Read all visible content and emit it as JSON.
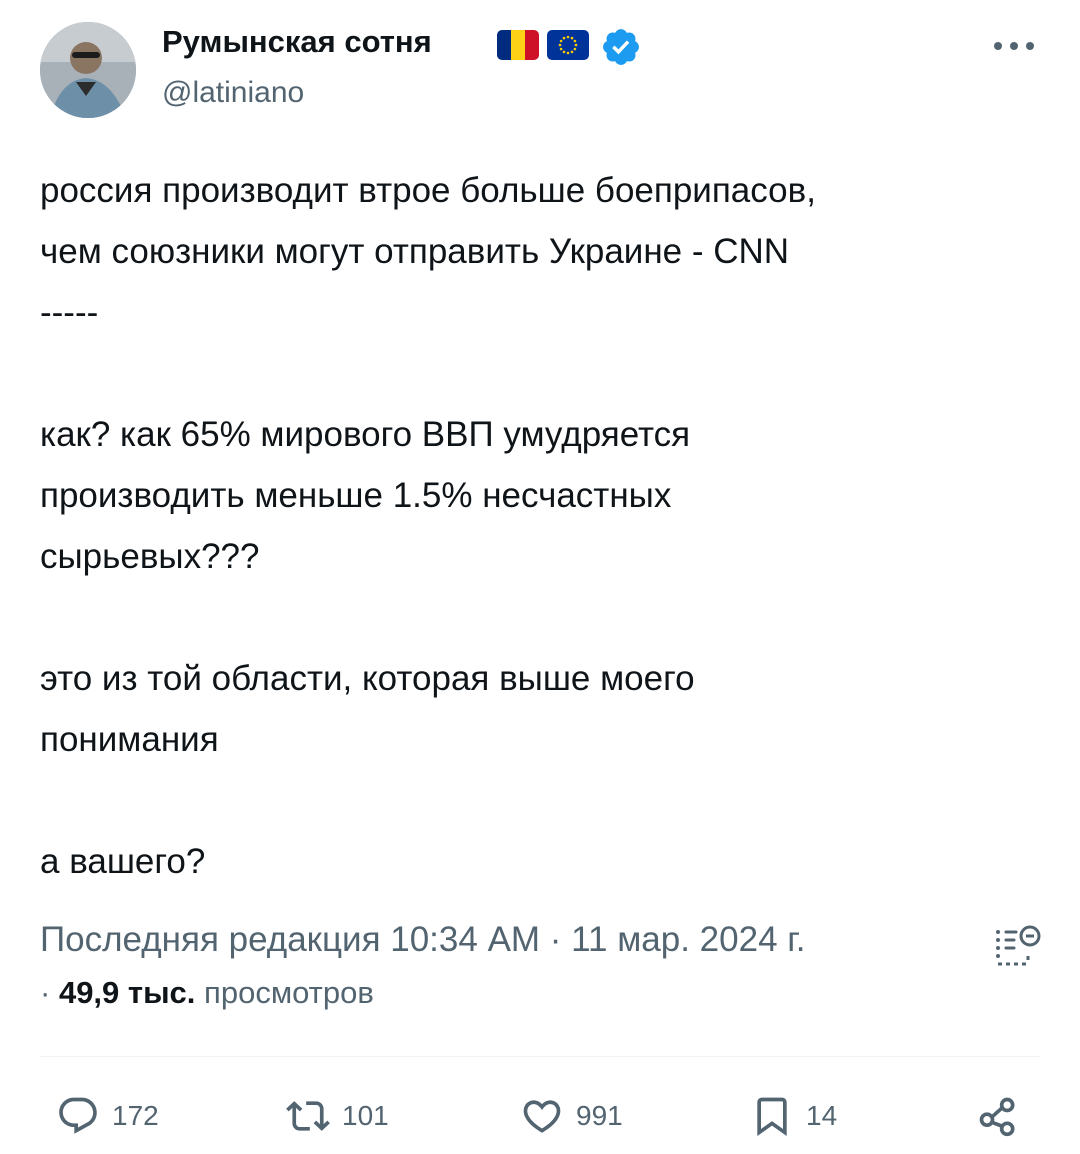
{
  "author": {
    "display_name": "Румынская сотня",
    "handle": "@latiniano",
    "flags": [
      "romania-flag",
      "eu-flag"
    ],
    "verified": true
  },
  "tweet": {
    "text": "россия производит втрое больше боеприпасов,\nчем союзники могут отправить Украине - CNN\n-----\n\nкак? как 65% мирового ВВП умудряется\nпроизводить меньше 1.5% несчастных\nсырьевых???\n\nэто из той области, которая выше моего\nпонимания\n\nа вашего?"
  },
  "meta": {
    "edited_label": "Последняя редакция 10:34 AM · 11 мар. 2024 г.",
    "separator": "·",
    "views_count": "49,9 тыс.",
    "views_label": "просмотров"
  },
  "actions": {
    "replies": "172",
    "reposts": "101",
    "likes": "991",
    "bookmarks": "14"
  },
  "colors": {
    "text": "#0f1419",
    "secondary": "#536471",
    "verified": "#1d9bf0",
    "divider": "#eff3f4"
  }
}
